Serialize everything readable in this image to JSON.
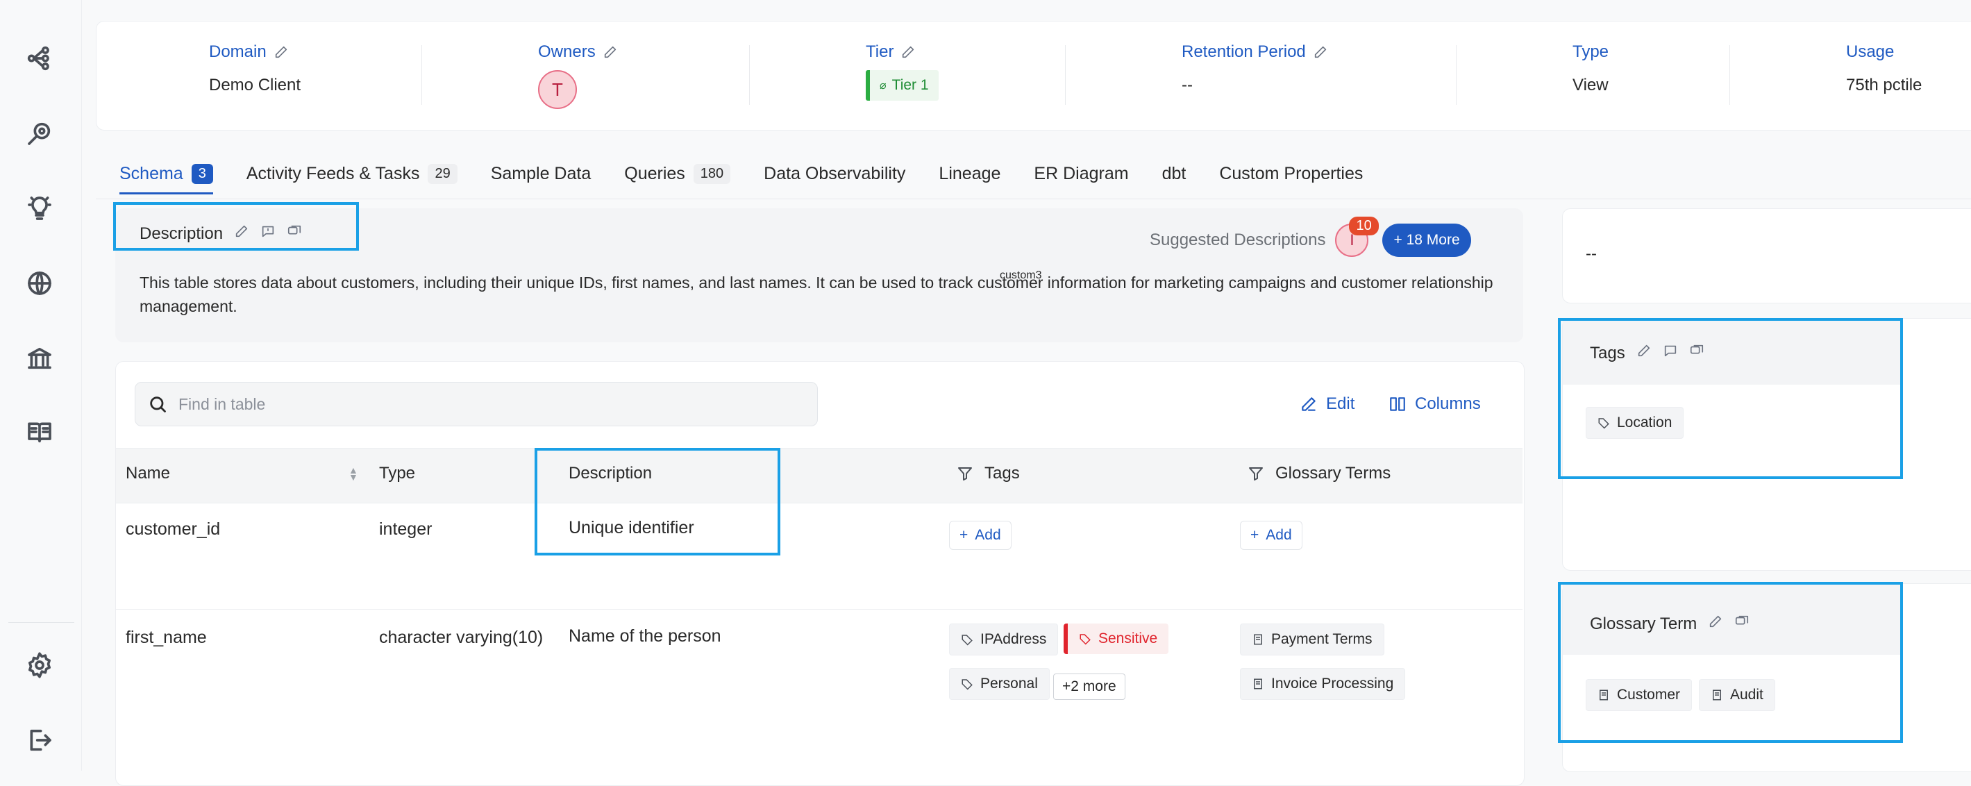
{
  "nav": {
    "icons": [
      "data-lineage-icon",
      "explore-icon",
      "insights-icon",
      "globe-icon",
      "governance-icon",
      "docs-icon",
      "settings-icon",
      "logout-icon"
    ]
  },
  "header": {
    "domain": {
      "label": "Domain",
      "value": "Demo Client"
    },
    "owners": {
      "label": "Owners",
      "avatar": "T"
    },
    "tier": {
      "label": "Tier",
      "value": "Tier 1"
    },
    "retention": {
      "label": "Retention Period",
      "value": "--"
    },
    "type": {
      "label": "Type",
      "value": "View"
    },
    "usage": {
      "label": "Usage",
      "value": "75th pctile"
    }
  },
  "tabs": [
    {
      "label": "Schema",
      "count": "3"
    },
    {
      "label": "Activity Feeds & Tasks",
      "count": "29"
    },
    {
      "label": "Sample Data"
    },
    {
      "label": "Queries",
      "count": "180"
    },
    {
      "label": "Data Observability"
    },
    {
      "label": "Lineage"
    },
    {
      "label": "ER Diagram"
    },
    {
      "label": "dbt"
    },
    {
      "label": "Custom Properties"
    }
  ],
  "description": {
    "title": "Description",
    "text": "This table stores data about customers, including their unique IDs, first names, and last names. It can be used to track customer information for marketing campaigns and customer relationship management.",
    "overlay_label": "custom3",
    "suggested_label": "Suggested Descriptions",
    "suggested_avatar": "I",
    "suggested_count": "10",
    "more_button": "+ 18 More"
  },
  "table": {
    "search_placeholder": "Find in table",
    "edit_label": "Edit",
    "columns_label": "Columns",
    "headers": {
      "name": "Name",
      "type": "Type",
      "description": "Description",
      "tags": "Tags",
      "glossary": "Glossary Terms"
    },
    "add_label": "Add",
    "rows": [
      {
        "name": "customer_id",
        "type": "integer",
        "description": "Unique identifier"
      },
      {
        "name": "first_name",
        "type": "character varying(10)",
        "description": "Name of the person",
        "tags": [
          "IPAddress",
          "Sensitive",
          "Personal"
        ],
        "more": "+2 more",
        "glossary": [
          "Payment Terms",
          "Invoice Processing"
        ]
      }
    ]
  },
  "right_panel": {
    "empty_value": "--",
    "tags_title": "Tags",
    "tags": [
      "Location"
    ],
    "glossary_title": "Glossary Term",
    "glossary": [
      "Customer",
      "Audit"
    ]
  },
  "colors": {
    "accent": "#1f5ac2",
    "highlight": "#1aa0e6",
    "tier_green": "#2bad42",
    "sensitive_red": "#e0242d"
  }
}
